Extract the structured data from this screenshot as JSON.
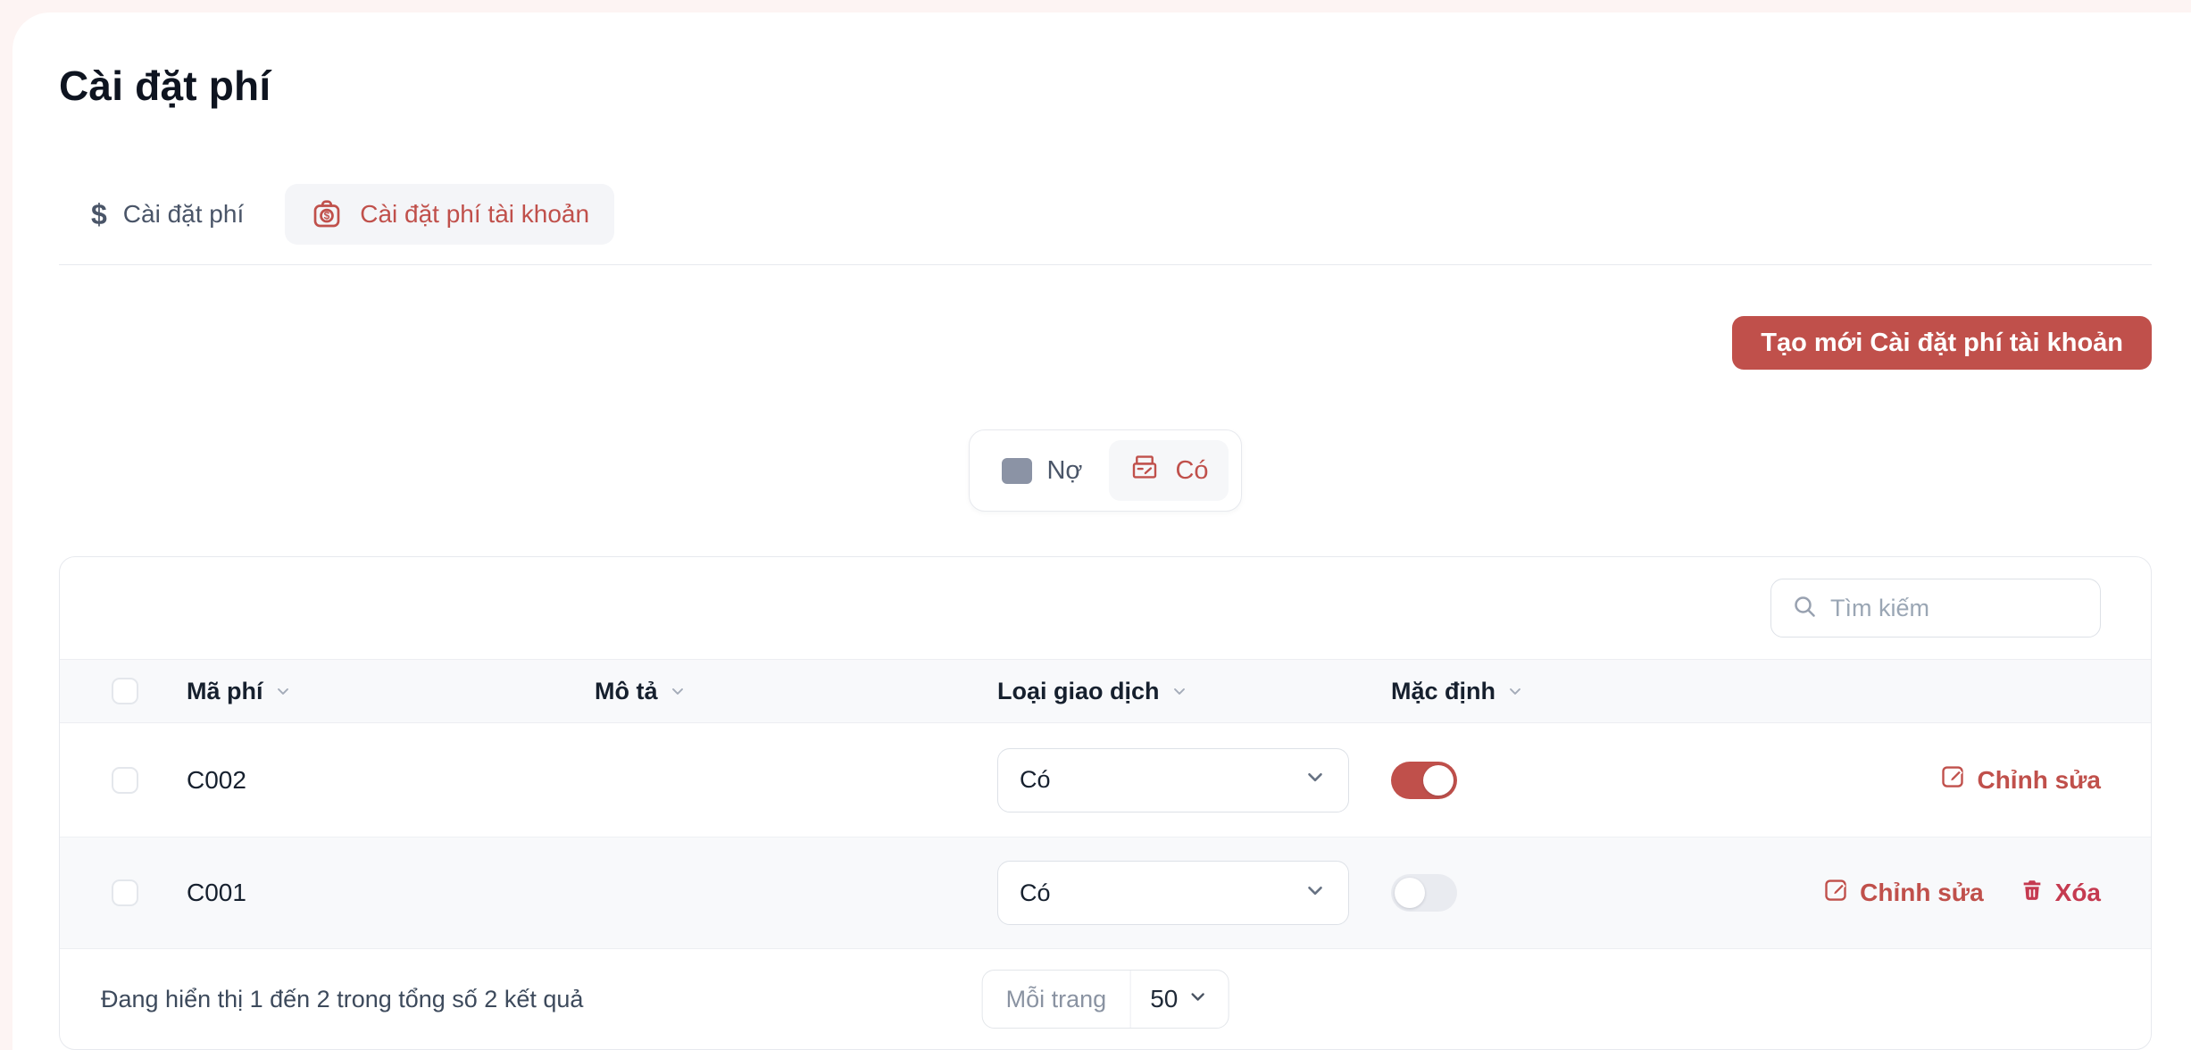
{
  "page": {
    "title": "Cài đặt phí"
  },
  "tabs": [
    {
      "label": "Cài đặt phí",
      "icon": "dollar-icon",
      "active": false
    },
    {
      "label": "Cài đặt phí tài khoản",
      "icon": "money-bag-icon",
      "active": true
    }
  ],
  "icons": {
    "dollar_glyph": "$"
  },
  "create_button": {
    "label": "Tạo mới Cài đặt phí tài khoản"
  },
  "type_switcher": {
    "options": [
      {
        "label": "Nợ",
        "icon": "debit-icon",
        "active": false
      },
      {
        "label": "Có",
        "icon": "credit-icon",
        "active": true
      }
    ]
  },
  "search": {
    "placeholder": "Tìm kiếm",
    "value": ""
  },
  "table": {
    "columns": [
      "Mã phí",
      "Mô tả",
      "Loại giao dịch",
      "Mặc định"
    ],
    "rows": [
      {
        "code": "C002",
        "description": "",
        "transaction_type": "Có",
        "default_on": true,
        "actions": {
          "edit": "Chỉnh sửa"
        }
      },
      {
        "code": "C001",
        "description": "",
        "transaction_type": "Có",
        "default_on": false,
        "actions": {
          "edit": "Chỉnh sửa",
          "delete": "Xóa"
        }
      }
    ]
  },
  "pagination": {
    "summary": "Đang hiển thị 1 đến 2 trong tổng số 2 kết quả",
    "per_page_label": "Mỗi trang",
    "per_page_value": "50"
  },
  "colors": {
    "accent_red": "#c0504b",
    "delete_red": "#c53a50",
    "background_pink": "#fdf4f3",
    "toggle_off": "#e9ebf0"
  }
}
